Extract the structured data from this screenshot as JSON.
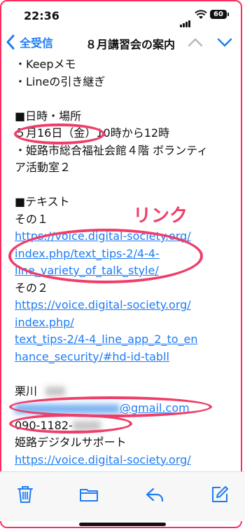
{
  "status_bar": {
    "time": "22:36",
    "battery": "60"
  },
  "nav": {
    "back_label": "全受信",
    "title": "８月講習会の案内"
  },
  "body_lines": {
    "l1": "・Keepメモ",
    "l2": "・Lineの引き継ぎ",
    "l3": "■日時・場所",
    "l4": "５月16日（金）10時から12時",
    "l5": "・姫路市総合福祉会館４階 ボランティ",
    "l6": "ア活動室２",
    "l7": "■テキスト",
    "l8": "その１",
    "link1_a": "https://voice.digital-society.org/",
    "link1_b": "index.php/text_tips-2/4-4-",
    "link1_c": "line_variety_of_talk_style/",
    "l9": "その２",
    "link2_a": "https://voice.digital-society.org/",
    "link2_b": "index.php/",
    "link2_c": "text_tips-2/4-4_line_app_2_to_en",
    "link2_d": "hance_security/#hd-id-tabll",
    "name": "栗川",
    "email_domain": "@gmail.com",
    "phone_prefix": "090-1182-",
    "org": "姫路デジタルサポート",
    "org_link": "https://voice.digital-society.org/"
  },
  "annotation": {
    "label": "リンク",
    "color": "#ef3e6a"
  },
  "toolbar": {
    "icons": [
      "trash-icon",
      "folder-icon",
      "reply-icon",
      "compose-icon"
    ]
  },
  "colors": {
    "accent": "#1f7cf5",
    "annotation": "#ef3e6a"
  }
}
